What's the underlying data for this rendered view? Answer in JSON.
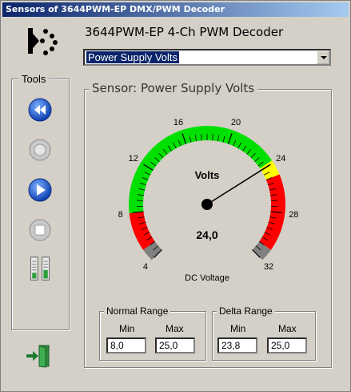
{
  "window": {
    "title": "Sensors of 3644PWM-EP DMX/PWM   Decoder"
  },
  "header": {
    "device_name": "3644PWM-EP 4-Ch PWM Decoder"
  },
  "sensor_select": {
    "selected": "Power Supply Volts"
  },
  "tools": {
    "label": "Tools",
    "items": [
      {
        "name": "rewind-icon"
      },
      {
        "name": "record-icon"
      },
      {
        "name": "play-icon"
      },
      {
        "name": "stop-icon"
      },
      {
        "name": "level-meter-icon"
      }
    ]
  },
  "sensor": {
    "frame_label": "Sensor: Power Supply Volts",
    "gauge": {
      "unit_label": "Volts",
      "value_text": "24,0",
      "value": 24.0,
      "min": 4,
      "max": 32,
      "caption": "DC Voltage",
      "tick_labels": [
        "4",
        "8",
        "12",
        "16",
        "20",
        "24",
        "28",
        "32"
      ],
      "zones": [
        {
          "from": 4,
          "to": 5,
          "color": "#808080"
        },
        {
          "from": 5,
          "to": 8,
          "color": "#ff0000"
        },
        {
          "from": 8,
          "to": 23.8,
          "color": "#00e000"
        },
        {
          "from": 23.8,
          "to": 25,
          "color": "#ffff00"
        },
        {
          "from": 25,
          "to": 31,
          "color": "#ff0000"
        },
        {
          "from": 31,
          "to": 32,
          "color": "#808080"
        }
      ]
    },
    "normal_range": {
      "label": "Normal Range",
      "min_label": "Min",
      "max_label": "Max",
      "min": "8,0",
      "max": "25,0"
    },
    "delta_range": {
      "label": "Delta Range",
      "min_label": "Min",
      "max_label": "Max",
      "min": "23,8",
      "max": "25,0"
    }
  },
  "exit": {
    "icon": "exit-door-icon"
  }
}
